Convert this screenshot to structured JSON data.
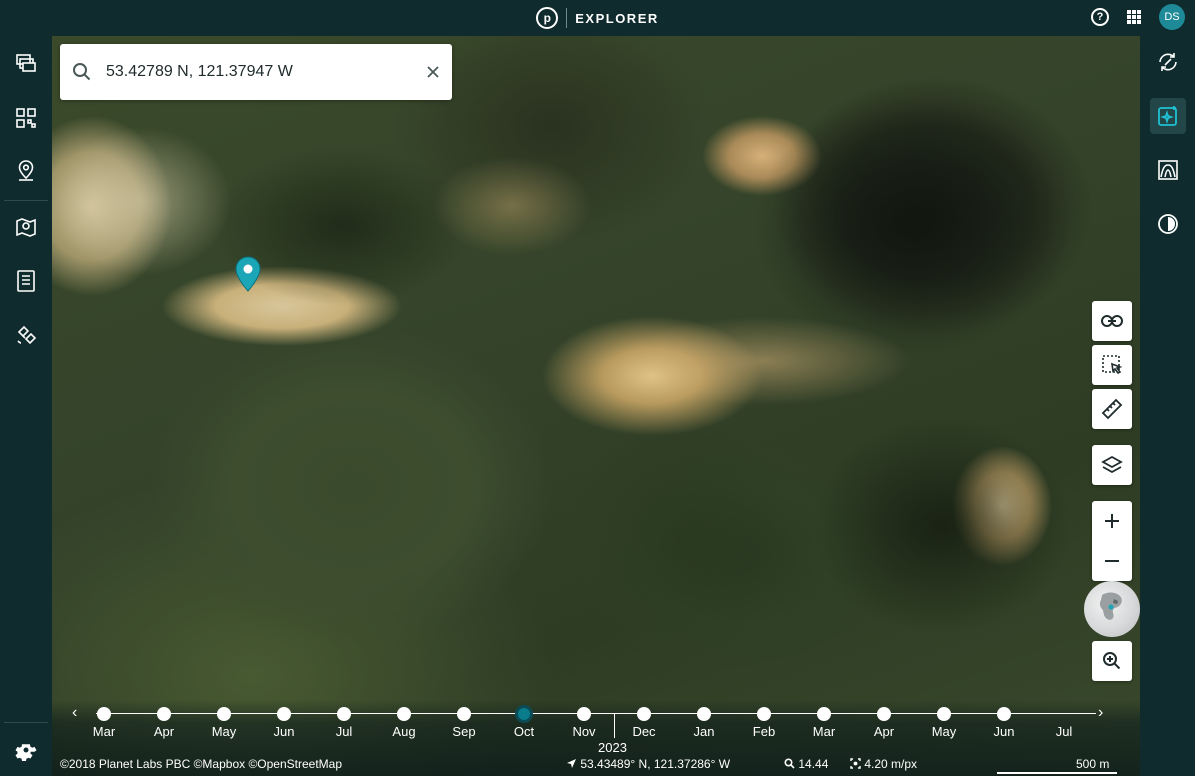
{
  "topbar": {
    "logo_letter": "p",
    "title": "EXPLORER",
    "help_label": "?",
    "avatar_initials": "DS"
  },
  "search": {
    "value": "53.42789 N, 121.37947 W"
  },
  "timeline": {
    "months": [
      "Mar",
      "Apr",
      "May",
      "Jun",
      "Jul",
      "Aug",
      "Sep",
      "Oct",
      "Nov",
      "Dec",
      "Jan",
      "Feb",
      "Mar",
      "Apr",
      "May",
      "Jun",
      "Jul"
    ],
    "active_month_index": 7,
    "year_label": "2023"
  },
  "footer": {
    "attribution": "©2018 Planet Labs PBC ©Mapbox ©OpenStreetMap",
    "cursor_coords": "53.43489° N, 121.37286° W",
    "zoom_level": "14.44",
    "resolution": "4.20 m/px",
    "scale": "500 m"
  },
  "colors": {
    "chrome": "#0f2b2d",
    "accent": "#1e8a98",
    "pin": "#1aa6b7"
  }
}
